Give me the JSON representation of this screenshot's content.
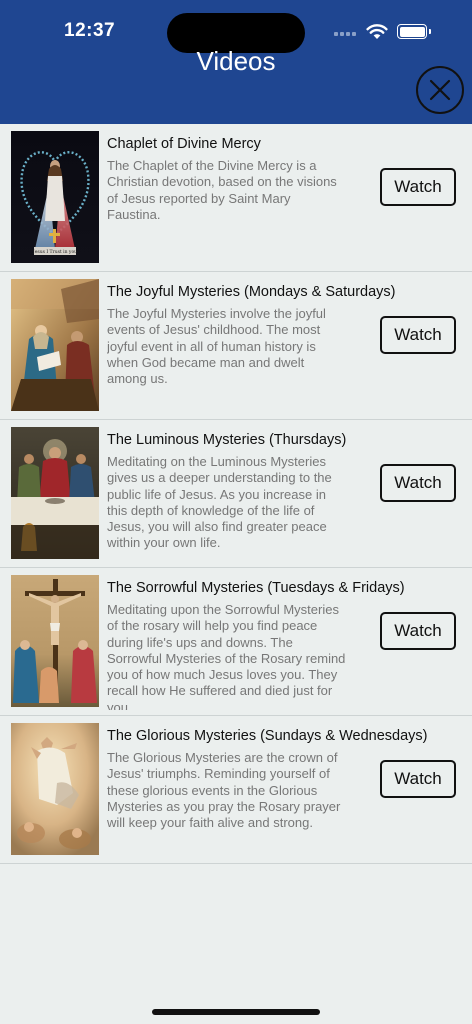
{
  "status": {
    "time": "12:37"
  },
  "header": {
    "title": "Videos"
  },
  "videos": [
    {
      "title": "Chaplet of Divine Mercy",
      "description": "The Chaplet of the Divine Mercy is a Christian devotion, based on the visions of Jesus reported by Saint Mary Faustina.",
      "button": "Watch",
      "image": "divine-mercy-image"
    },
    {
      "title": "The Joyful Mysteries (Mondays & Saturdays)",
      "description": "The Joyful Mysteries involve the joyful events of Jesus' childhood. The most joyful event in all of human history is when God became man and dwelt among us.",
      "button": "Watch",
      "image": "nativity-image"
    },
    {
      "title": "The Luminous Mysteries (Thursdays)",
      "description": "Meditating on the Luminous Mysteries gives us a deeper understanding to the public life of Jesus. As you increase in this depth of knowledge of the life of Jesus, you will also find greater peace within your own life.",
      "button": "Watch",
      "image": "last-supper-image"
    },
    {
      "title": "The Sorrowful Mysteries (Tuesdays & Fridays)",
      "description": "Meditating upon the Sorrowful Mysteries of the rosary will help you find peace during life's ups and downs. The Sorrowful Mysteries of the Rosary remind you of how much Jesus loves you. They recall how He suffered and died just for you.",
      "button": "Watch",
      "image": "crucifixion-image"
    },
    {
      "title": "The Glorious Mysteries (Sundays & Wednesdays)",
      "description": "The Glorious Mysteries are the crown of Jesus' triumphs. Reminding yourself of these glorious events in the Glorious Mysteries as you pray the Rosary prayer will keep your faith alive and strong.",
      "button": "Watch",
      "image": "ascension-image"
    }
  ],
  "thumbnail_caption": "Jesus I Trust in you",
  "colors": {
    "header": "#1f4691",
    "background": "#ebefee",
    "text": "#111111",
    "description": "#777777"
  }
}
